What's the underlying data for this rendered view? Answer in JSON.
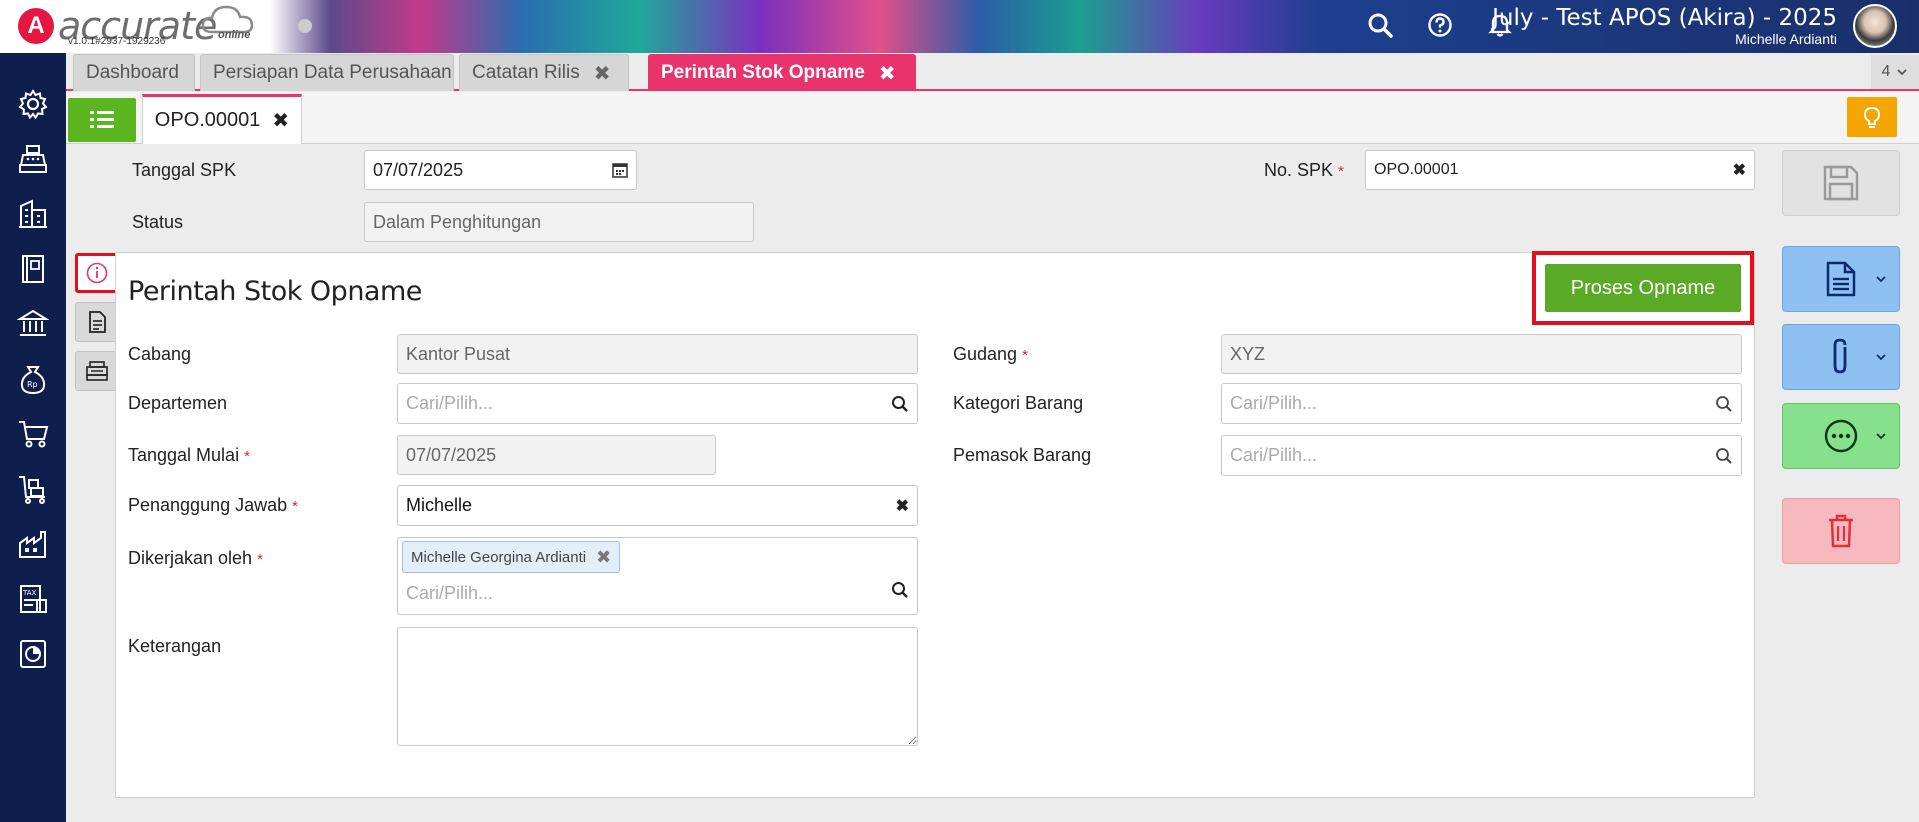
{
  "header": {
    "logo_mark": "A",
    "logo_text": "accurate",
    "logo_sub": "online",
    "version": "v1.0.1#2937-1929236",
    "company": "July - Test APOS (Akira) - 2025",
    "user": "Michelle Ardianti",
    "icons": [
      "search-icon",
      "help-icon",
      "bell-icon"
    ]
  },
  "sidebar": {
    "items": [
      "gear-icon",
      "cash-register-icon",
      "building-icon",
      "ledger-icon",
      "bank-icon",
      "money-bag-icon",
      "cart-icon",
      "inventory-icon",
      "factory-icon",
      "tax-icon",
      "report-icon"
    ]
  },
  "tabs": [
    {
      "label": "Dashboard",
      "closable": false
    },
    {
      "label": "Persiapan Data Perusahaan",
      "closable": false
    },
    {
      "label": "Catatan Rilis",
      "closable": true
    },
    {
      "label": "Perintah Stok Opname",
      "closable": true,
      "active": true
    }
  ],
  "tab_count": "4",
  "doc_tab": {
    "label": "OPO.00001"
  },
  "top_form": {
    "tanggal_spk_label": "Tanggal SPK",
    "tanggal_spk_value": "07/07/2025",
    "status_label": "Status",
    "status_value": "Dalam Penghitungan",
    "no_spk_label": "No. SPK",
    "no_spk_value": "OPO.00001"
  },
  "panel": {
    "title": "Perintah Stok Opname",
    "proses_button": "Proses Opname",
    "cabang_label": "Cabang",
    "cabang_value": "Kantor Pusat",
    "departemen_label": "Departemen",
    "departemen_placeholder": "Cari/Pilih...",
    "tanggal_mulai_label": "Tanggal Mulai",
    "tanggal_mulai_value": "07/07/2025",
    "penanggung_label": "Penanggung Jawab",
    "penanggung_value": "Michelle",
    "dikerjakan_label": "Dikerjakan oleh",
    "dikerjakan_chip": "Michelle Georgina Ardianti",
    "dikerjakan_placeholder": "Cari/Pilih...",
    "keterangan_label": "Keterangan",
    "gudang_label": "Gudang",
    "gudang_value": "XYZ",
    "kategori_label": "Kategori Barang",
    "kategori_placeholder": "Cari/Pilih...",
    "pemasok_label": "Pemasok Barang",
    "pemasok_placeholder": "Cari/Pilih..."
  },
  "required_mark": "*",
  "close_glyph": "✖",
  "colors": {
    "accent": "#e8336d",
    "sidebar": "#0f1f4d",
    "success": "#5aaa25",
    "highlight": "#e2101f",
    "warning": "#f5a500"
  }
}
